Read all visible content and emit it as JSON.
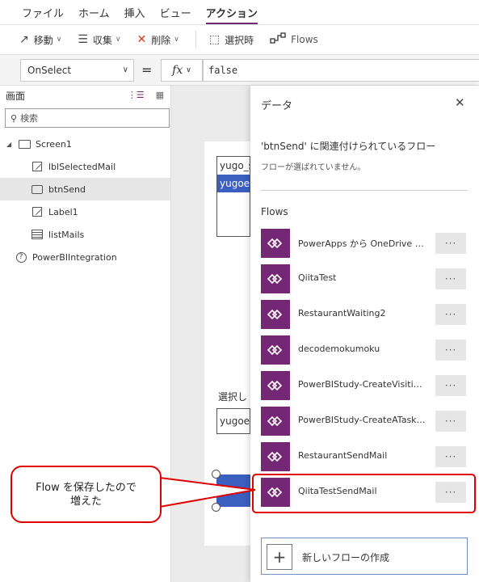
{
  "menu": {
    "items": [
      {
        "label": "ファイル"
      },
      {
        "label": "ホーム"
      },
      {
        "label": "挿入"
      },
      {
        "label": "ビュー"
      },
      {
        "label": "アクション",
        "active": true
      }
    ]
  },
  "toolbar": {
    "move_label": "移動",
    "collect_label": "収集",
    "delete_label": "削除",
    "on_select_label": "選択時",
    "flows_label": "Flows"
  },
  "formula": {
    "property": "OnSelect",
    "equals": "=",
    "fx": "fx",
    "value": "false"
  },
  "tree": {
    "header": "画面",
    "search_placeholder": "検索",
    "nodes": [
      {
        "label": "Screen1"
      },
      {
        "label": "lblSelectedMail"
      },
      {
        "label": "btnSend",
        "selected": true
      },
      {
        "label": "Label1"
      },
      {
        "label": "listMails"
      },
      {
        "label": "PowerBIIntegration"
      }
    ]
  },
  "canvas": {
    "list_row1": "yugo_s",
    "list_row2": "yugoes",
    "select_label": "選択し",
    "selected_mail": "yugoes"
  },
  "data_panel": {
    "title": "データ",
    "subtitle": "'btnSend' に関連付けられているフロー",
    "no_flow": "フローが選ばれていません。",
    "flows_header": "Flows",
    "flows": [
      {
        "label": "PowerApps から OneDrive へ..."
      },
      {
        "label": "QiitaTest"
      },
      {
        "label": "RestaurantWaiting2"
      },
      {
        "label": "decodemokumoku"
      },
      {
        "label": "PowerBIStudy-CreateVisitin..."
      },
      {
        "label": "PowerBIStudy-CreateATaskF..."
      },
      {
        "label": "RestaurantSendMail"
      },
      {
        "label": "QiitaTestSendMail"
      }
    ],
    "more_label": "···",
    "new_flow_label": "新しいフローの作成"
  },
  "callout": {
    "line1": "Flow を保存したので",
    "line2": "増えた"
  },
  "colors": {
    "accent": "#742774",
    "highlight": "#e00000",
    "selection_blue": "#3b5fc0"
  }
}
